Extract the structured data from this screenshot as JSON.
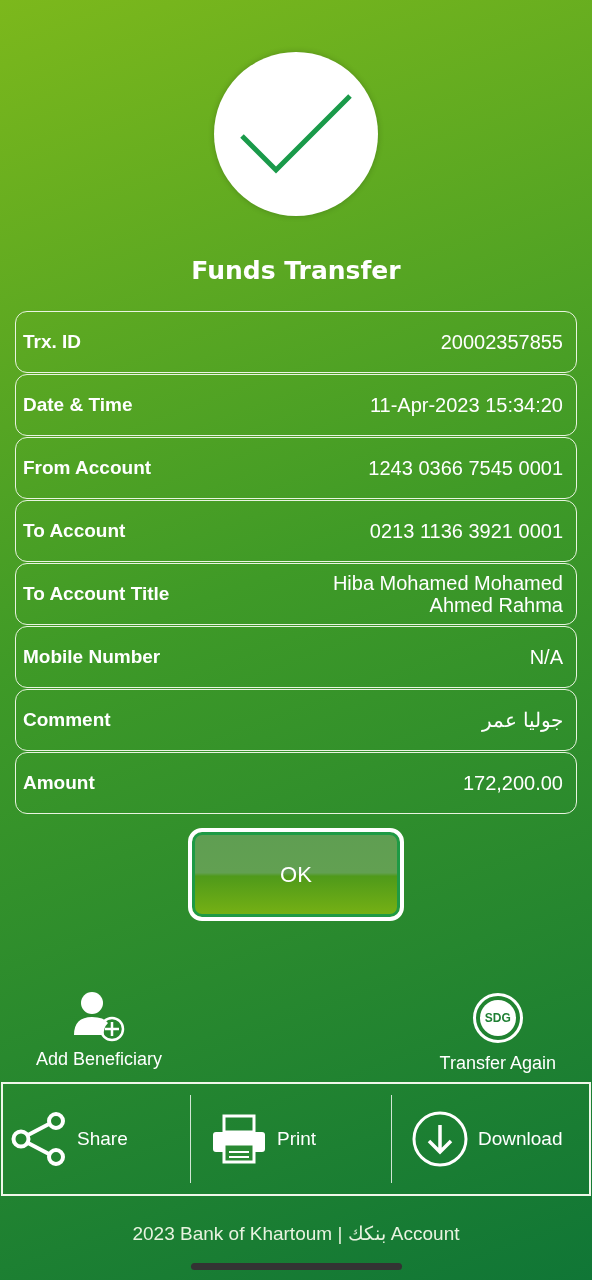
{
  "title": "Funds Transfer",
  "details": [
    {
      "label": "Trx. ID",
      "value": "20002357855"
    },
    {
      "label": "Date & Time",
      "value": "11-Apr-2023 15:34:20"
    },
    {
      "label": "From Account",
      "value": "1243 0366 7545 0001"
    },
    {
      "label": "To Account",
      "value": "0213 1136 3921 0001"
    },
    {
      "label": "To Account Title",
      "value": "Hiba Mohamed Mohamed Ahmed Rahma"
    },
    {
      "label": "Mobile Number",
      "value": "N/A"
    },
    {
      "label": "Comment",
      "value": "جوليا عمر"
    },
    {
      "label": "Amount",
      "value": "172,200.00"
    }
  ],
  "ok_button": "OK",
  "quick_actions": [
    {
      "kind": "beneficiary",
      "label": "Add Beneficiary"
    },
    {
      "kind": "currency",
      "label": "Transfer Again",
      "badge": "SDG"
    }
  ],
  "toolbar": [
    {
      "kind": "share",
      "label": "Share"
    },
    {
      "kind": "print",
      "label": "Print"
    },
    {
      "kind": "download",
      "label": "Download"
    }
  ],
  "footer": "2023 Bank of Khartoum | بنكك Account"
}
